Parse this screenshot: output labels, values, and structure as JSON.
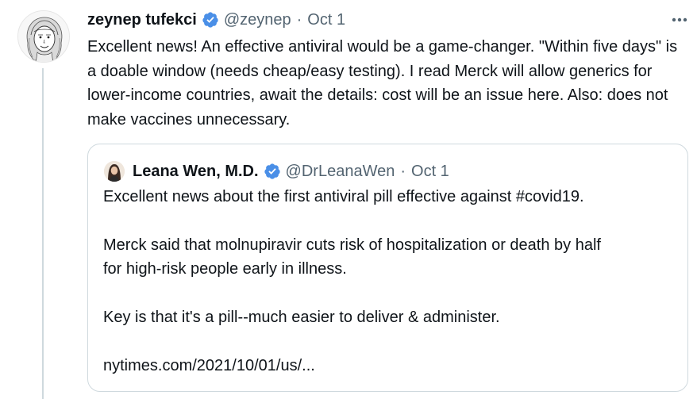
{
  "tweet": {
    "author_name": "zeynep tufekci",
    "handle": "@zeynep",
    "separator": "·",
    "date": "Oct 1",
    "avatar_icon": "portrait-sketch-avatar",
    "more_icon": "more-horizontal-icon",
    "text": "Excellent news! An effective antiviral would be a game-changer. \"Within five days\" is a doable window (needs cheap/easy testing). I read Merck will allow generics for lower-income countries, await the details: cost will be an issue here. Also: does not make vaccines unnecessary."
  },
  "quoted_tweet": {
    "author_name": "Leana Wen, M.D.",
    "handle": "@DrLeanaWen",
    "separator": "·",
    "date": "Oct 1",
    "avatar_icon": "profile-photo-avatar",
    "lines": [
      "Excellent news about the first antiviral pill effective against #covid19.",
      "Merck said that molnupiravir cuts risk of hospitalization or death by half",
      "for high-risk people early in illness.",
      "Key is that it's a pill--much easier to deliver & administer.",
      "nytimes.com/2021/10/01/us/..."
    ]
  },
  "colors": {
    "verified_badge": "#4a8fe7",
    "secondary_text": "#536471",
    "border": "#cfd9de"
  }
}
